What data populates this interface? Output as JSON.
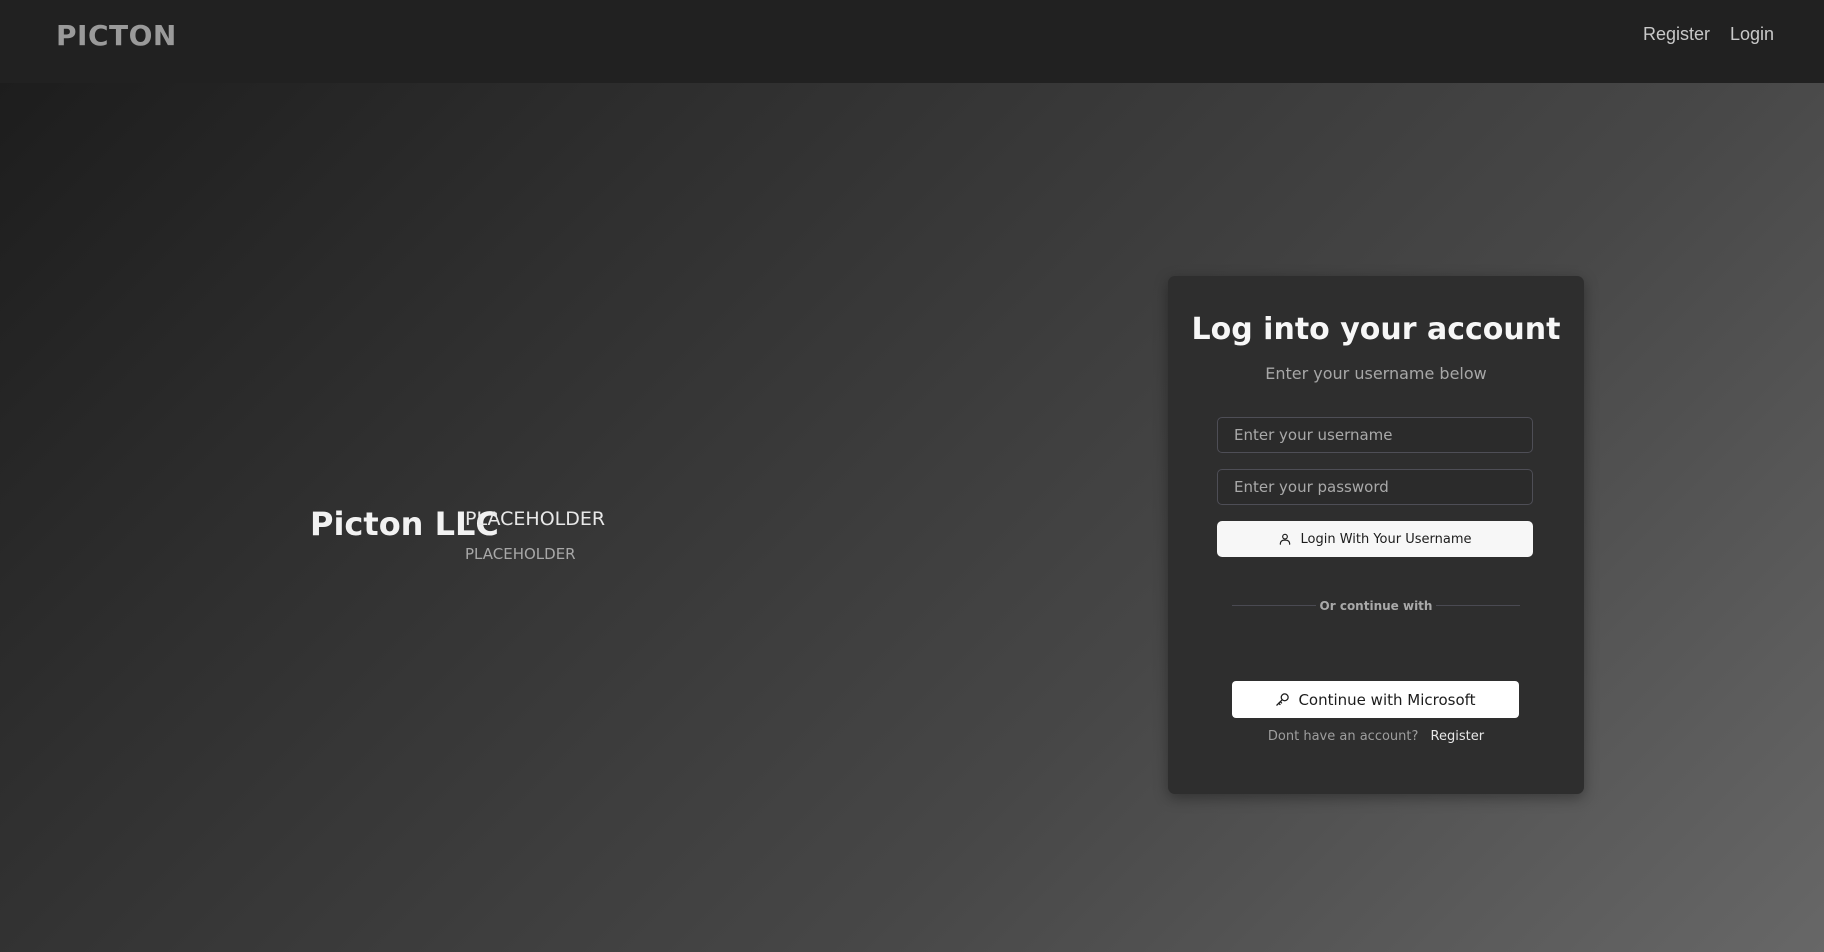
{
  "header": {
    "brand": "PICTON",
    "nav": {
      "register": "Register",
      "login": "Login"
    }
  },
  "hero": {
    "company": "Picton LLC",
    "tagline": "PLACEHOLDER",
    "tagline_sub": "PLACEHOLDER"
  },
  "login_card": {
    "title": "Log into your account",
    "subtitle": "Enter your username below",
    "username_placeholder": "Enter your username",
    "password_placeholder": "Enter your password",
    "login_button": "Login With Your Username",
    "login_button_icon": "user-icon",
    "divider_text": "Or continue with",
    "microsoft_button": "Continue with Microsoft",
    "microsoft_button_icon": "key-icon",
    "footer_text": "Dont have an account?",
    "footer_link": "Register"
  }
}
